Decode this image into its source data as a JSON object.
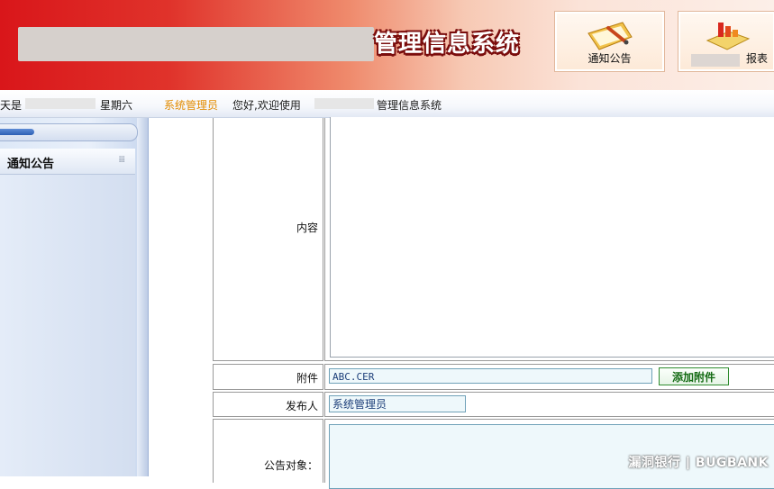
{
  "header": {
    "system_title": "管理信息系统",
    "buttons": [
      {
        "label": "通知公告",
        "icon": "notice-icon"
      },
      {
        "label": "报表",
        "icon": "report-chart-icon"
      }
    ]
  },
  "infobar": {
    "day_prefix": "天是",
    "weekday": "星期六",
    "role": "系统管理员",
    "welcome": "您好,欢迎使用",
    "system_name": "管理信息系统"
  },
  "sidebar": {
    "section_title": "通知公告",
    "grip_icon": "grip-dots-icon"
  },
  "form": {
    "content_label": "内容",
    "attachment_label": "附件",
    "attachment_value": "ABC.CER",
    "add_attachment_button": "添加附件",
    "publisher_label": "发布人",
    "publisher_value": "系统管理员",
    "target_label": "公告对象："
  },
  "watermark": "漏洞银行 | BUGBANK",
  "colors": {
    "banner_red": "#d9161a",
    "role_text": "#e28b00",
    "add_button_green": "#146b14"
  }
}
